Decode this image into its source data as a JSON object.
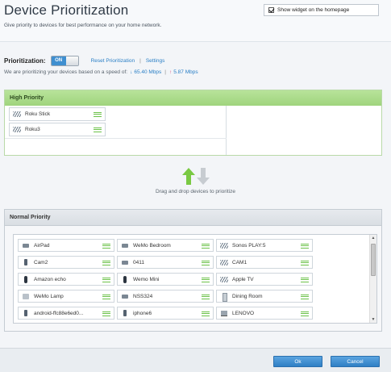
{
  "header": {
    "title": "Device Prioritization",
    "subtitle": "Give priority to devices for best performance on your home network.",
    "widget_label": "Show widget on the homepage",
    "widget_checked": true
  },
  "prioritization": {
    "label": "Prioritization:",
    "toggle_state": "ON",
    "reset_link": "Reset Prioritization",
    "separator": "|",
    "settings_link": "Settings",
    "speed_prefix": "We are prioritizing your devices based on a speed of:",
    "download_arrow": "↓",
    "download_speed": "65.40 Mbps",
    "speed_separator": "|",
    "upload_arrow": "↑",
    "upload_speed": "5.87 Mbps"
  },
  "high_priority": {
    "title": "High Priority",
    "devices": [
      {
        "name": "Roku Stick",
        "icon": "wifi-icon"
      },
      {
        "name": "Roku3",
        "icon": "wifi-icon"
      }
    ]
  },
  "drag": {
    "text": "Drag and drop devices to prioritize",
    "up_color": "#7ac943",
    "down_color": "#c7ccd1"
  },
  "normal_priority": {
    "title": "Normal Priority",
    "rows": [
      [
        {
          "name": "AirPad",
          "icon": "box-icon"
        },
        {
          "name": "WeMo Bedroom",
          "icon": "box-icon"
        },
        {
          "name": "Sonos PLAY:5",
          "icon": "wifi-icon"
        }
      ],
      [
        {
          "name": "Cam2",
          "icon": "phone-icon"
        },
        {
          "name": "0411",
          "icon": "box-icon"
        },
        {
          "name": "CAM1",
          "icon": "wifi-icon"
        }
      ],
      [
        {
          "name": "Amazon echo",
          "icon": "cylinder-icon"
        },
        {
          "name": "Wemo Mini",
          "icon": "cylinder-icon"
        },
        {
          "name": "Apple TV",
          "icon": "wifi-icon"
        }
      ],
      [
        {
          "name": "WeMo Lamp",
          "icon": "lamp-icon"
        },
        {
          "name": "NSS324",
          "icon": "box-icon"
        },
        {
          "name": "Dining Room",
          "icon": "tower-icon"
        }
      ],
      [
        {
          "name": "android-ffc88e6ed0...",
          "icon": "phone-icon"
        },
        {
          "name": "iphone6",
          "icon": "phone-icon"
        },
        {
          "name": "LENOVO",
          "icon": "laptop-icon"
        }
      ]
    ]
  },
  "footer": {
    "ok_label": "Ok",
    "cancel_label": "Cancel"
  },
  "colors": {
    "accent": "#2a7fc6",
    "high_priority_green": "#9fd47d",
    "grip_green": "#6cc24a"
  }
}
